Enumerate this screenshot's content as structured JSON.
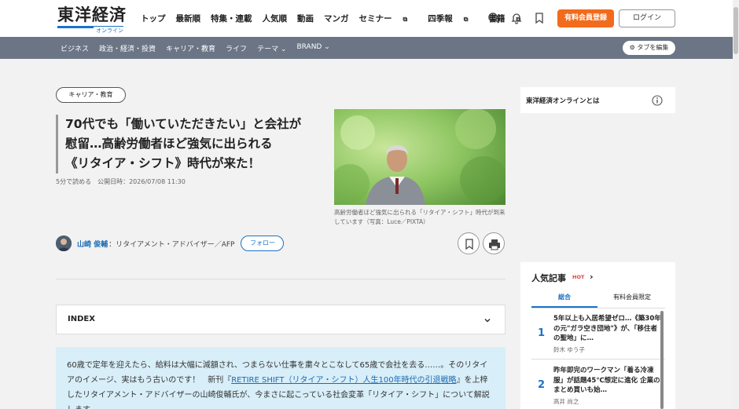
{
  "header": {
    "logo_main": "東洋経済",
    "logo_sub": "オンライン",
    "nav": [
      "トップ",
      "最新順",
      "特集・連載",
      "人気順",
      "動画",
      "マンガ",
      "セミナー",
      "四季報",
      "書籍"
    ],
    "register_label": "有料会員登録",
    "login_label": "ログイン"
  },
  "subnav": {
    "items": [
      "ビジネス",
      "政治・経済・投資",
      "キャリア・教育",
      "ライフ",
      "テーマ ⌄",
      "BRAND ⌄"
    ],
    "tab_edit_label": "タブを編集"
  },
  "article": {
    "category": "キャリア・教育",
    "title_lines": [
      "70代でも「働いていただきたい」と会社が",
      "慰留…高齢労働者ほど強気に出られる",
      "《リタイア・シフト》時代が来た！"
    ],
    "meta": "5分で読める　公開日時：2026/07/08 11:30",
    "caption": "高齢労働者ほど強気に出られる「リタイア・シフト」時代が到来しています（写真：Luce／PIXTA）",
    "author_name": "山崎 俊輔",
    "author_role": "：リタイアメント・アドバイザー／AFP",
    "follow_label": "フォロー",
    "index_label": "INDEX",
    "lead_part1": "60歳で定年を迎えたら、給料は大幅に減額され、つまらない仕事を粛々とこなして65歳で会社を去る……。そのリタイアのイメージ、実はもう古いのです！　新刊『",
    "lead_link": "RETIRE SHIFT（リタイア・シフト）人生100年時代の引退戦略",
    "lead_part2": "』を上梓したリタイアメント・アドバイザーの山崎俊輔氏が、今まさに起こっている社会変革「リタイア・シフト」について解説します。"
  },
  "sidebar": {
    "about_label": "東洋経済オンラインとは",
    "ranking_title": "人気記事",
    "hot_label": "HOT",
    "tabs": [
      "総合",
      "有料会員限定"
    ],
    "items": [
      {
        "num": "1",
        "text": "5年以上も入居希望ゼロ…《築30年の元\"ガラ空き団地\"》が、「移住者の聖地」に…",
        "author": "鈴木 ゆう子"
      },
      {
        "num": "2",
        "text": "昨年即完のワークマン「着る冷凍服」が話題45℃想定に進化 企業のまとめ買いも始…",
        "author": "高井 尚之"
      }
    ]
  }
}
